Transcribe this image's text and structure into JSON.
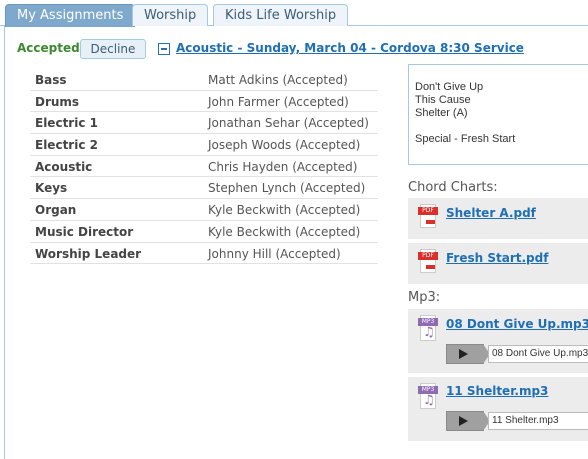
{
  "tabs": [
    {
      "label": "My Assignments",
      "active": true
    },
    {
      "label": "Worship",
      "active": false
    },
    {
      "label": "Kids Life Worship",
      "active": false
    }
  ],
  "status": {
    "accepted_label": "Accepted",
    "decline_label": "Decline"
  },
  "service_title": "Acoustic - Sunday, March 04 - Cordova 8:30 Service",
  "roster": [
    {
      "role": "Bass",
      "person": "Matt Adkins (Accepted)"
    },
    {
      "role": "Drums",
      "person": "John Farmer (Accepted)"
    },
    {
      "role": "Electric 1",
      "person": "Jonathan Sehar (Accepted)"
    },
    {
      "role": "Electric 2",
      "person": "Joseph Woods (Accepted)"
    },
    {
      "role": "Acoustic",
      "person": "Chris Hayden (Accepted)"
    },
    {
      "role": "Keys",
      "person": "Stephen Lynch (Accepted)"
    },
    {
      "role": "Organ",
      "person": "Kyle Beckwith (Accepted)"
    },
    {
      "role": "Music Director",
      "person": "Kyle Beckwith (Accepted)"
    },
    {
      "role": "Worship Leader",
      "person": "Johnny Hill (Accepted)"
    }
  ],
  "songs": [
    "Don't Give Up",
    "This Cause",
    "Shelter (A)",
    "",
    "Special - Fresh Start"
  ],
  "chord_charts": {
    "label": "Chord Charts:",
    "files": [
      {
        "name": "Shelter A.pdf",
        "icon": "pdf-icon"
      },
      {
        "name": "Fresh Start.pdf",
        "icon": "pdf-icon"
      }
    ]
  },
  "mp3": {
    "label": "Mp3:",
    "files": [
      {
        "name": "08 Dont Give Up.mp3",
        "player_value": "08 Dont Give Up.mp3",
        "icon": "mp3-icon"
      },
      {
        "name": "11 Shelter.mp3",
        "player_value": "11 Shelter.mp3",
        "icon": "mp3-icon"
      }
    ]
  },
  "colors": {
    "accent": "#1f6fb5",
    "accepted": "#3c8a2e",
    "tab_active": "#7fa9cc"
  }
}
